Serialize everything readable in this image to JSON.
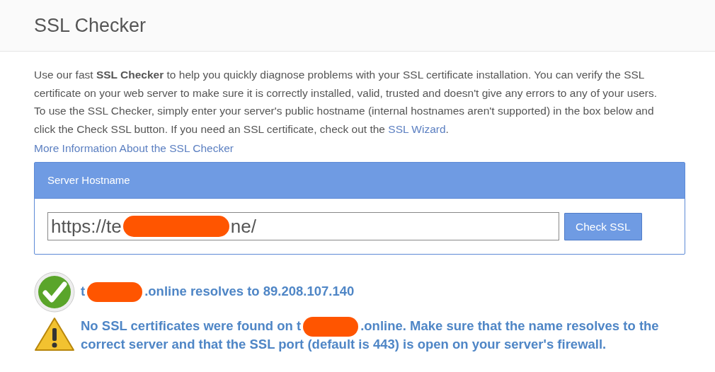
{
  "page": {
    "title": "SSL Checker"
  },
  "intro": {
    "text": "Use our fast **SSL Checker** to help you quickly diagnose problems with your SSL certificate installation. You can verify the SSL certificate on your web server to make sure it is correctly installed, valid, trusted and doesn't give any errors to any of your users. To use the SSL Checker, simply enter your server's public hostname (internal hostnames aren't supported) in the box below and click the Check SSL button. If you need an SSL certificate, check out the",
    "link": "SSL Wizard",
    "after": "."
  },
  "more_link": "More Information About the SSL Checker",
  "form": {
    "header": "Server Hostname",
    "value_parts": [
      "https://te",
      "ne/"
    ],
    "button": "Check SSL"
  },
  "results": [
    {
      "kind": "success",
      "parts": [
        "t",
        ".online resolves to 89.208.107.140"
      ]
    },
    {
      "kind": "warning",
      "parts": [
        "No SSL certificates were found on t",
        ".online. Make sure that the name resolves to the correct server and that the SSL port (default is 443) is open on your server's firewall."
      ]
    }
  ]
}
